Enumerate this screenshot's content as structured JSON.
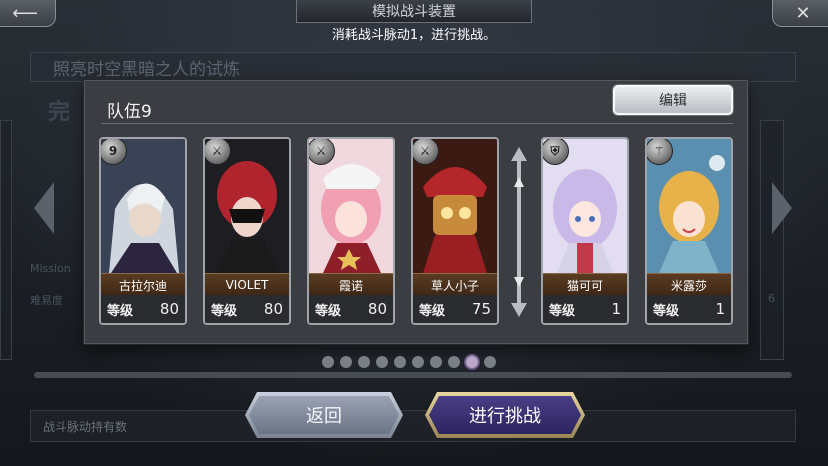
{
  "header": {
    "title": "模拟战斗装置",
    "subtitle": "消耗战斗脉动1，进行挑战。"
  },
  "background": {
    "stage_title": "照亮时空黑暗之人的试炼",
    "complete_label": "完",
    "mission_label": "Mission",
    "difficulty_label": "难易度",
    "right_number": "6",
    "pulse_label": "战斗脉动持有数"
  },
  "dialog": {
    "team_name": "队伍9",
    "edit_label": "编辑",
    "level_label": "等级",
    "characters": [
      {
        "name": "古拉尔迪",
        "level": "80",
        "class_icon": "number-9-icon"
      },
      {
        "name": "VIOLET",
        "level": "80",
        "class_icon": "sword-icon"
      },
      {
        "name": "霞诺",
        "level": "80",
        "class_icon": "sword-icon"
      },
      {
        "name": "草人小子",
        "level": "75",
        "class_icon": "sword-icon"
      },
      {
        "name": "猫可可",
        "level": "1",
        "class_icon": "shield-icon"
      },
      {
        "name": "米露莎",
        "level": "1",
        "class_icon": "staff-icon"
      }
    ]
  },
  "pagination": {
    "total": 10,
    "active": 9
  },
  "buttons": {
    "back_label": "返回",
    "challenge_label": "进行挑战"
  }
}
